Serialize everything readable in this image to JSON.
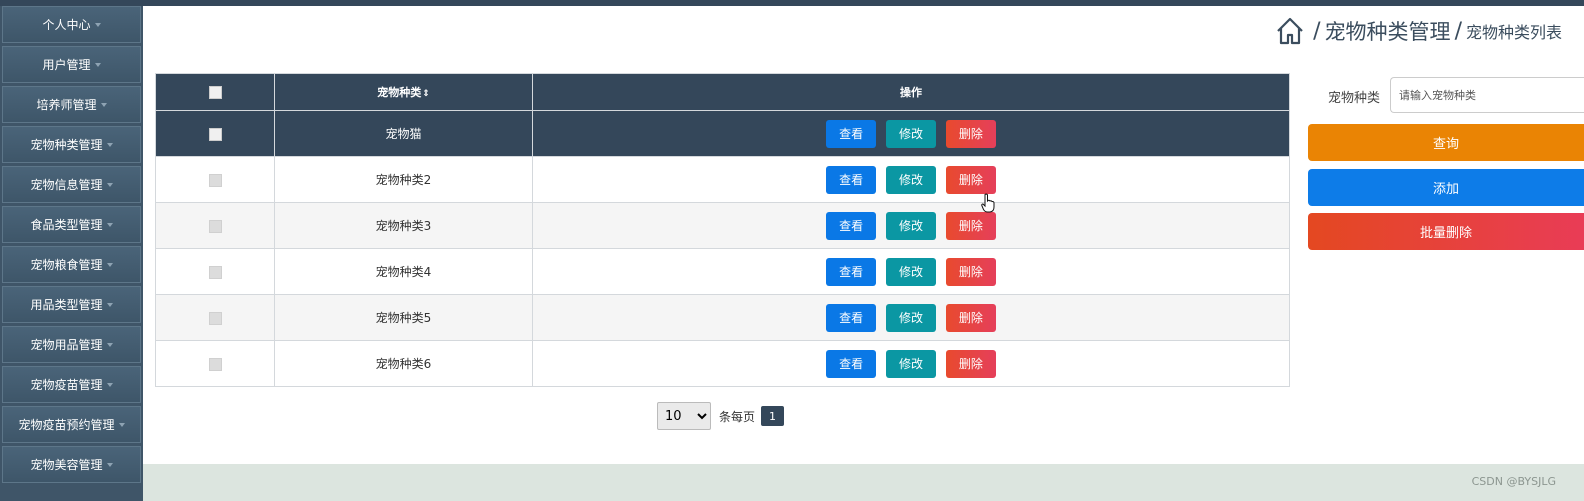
{
  "sidebar": {
    "items": [
      {
        "label": "个人中心"
      },
      {
        "label": "用户管理"
      },
      {
        "label": "培养师管理"
      },
      {
        "label": "宠物种类管理"
      },
      {
        "label": "宠物信息管理"
      },
      {
        "label": "食品类型管理"
      },
      {
        "label": "宠物粮食管理"
      },
      {
        "label": "用品类型管理"
      },
      {
        "label": "宠物用品管理"
      },
      {
        "label": "宠物疫苗管理"
      },
      {
        "label": "宠物疫苗预约管理"
      },
      {
        "label": "宠物美容管理"
      }
    ]
  },
  "breadcrumb": {
    "sep": "/",
    "level1": "宠物种类管理",
    "level2": "宠物种类列表"
  },
  "table": {
    "columns": [
      "宠物种类",
      "操作"
    ],
    "sort_icon": "⇕",
    "rows": [
      {
        "name": "宠物猫"
      },
      {
        "name": "宠物种类2"
      },
      {
        "name": "宠物种类3"
      },
      {
        "name": "宠物种类4"
      },
      {
        "name": "宠物种类5"
      },
      {
        "name": "宠物种类6"
      }
    ],
    "actions": {
      "view": "查看",
      "edit": "修改",
      "delete": "删除"
    }
  },
  "pagination": {
    "page_size": "10",
    "per_page_label": "条每页",
    "current_page": "1"
  },
  "search": {
    "label": "宠物种类",
    "placeholder": "请输入宠物种类",
    "query_button": "查询",
    "add_button": "添加",
    "batch_delete_button": "批量删除"
  },
  "watermark": "CSDN @BYSJLG",
  "colors": {
    "header_dark": "#34475a",
    "view": "#0a78e6",
    "edit": "#0b97a3",
    "delete": "#e84a2e",
    "query": "#ea8404",
    "add": "#0d7ce8"
  }
}
